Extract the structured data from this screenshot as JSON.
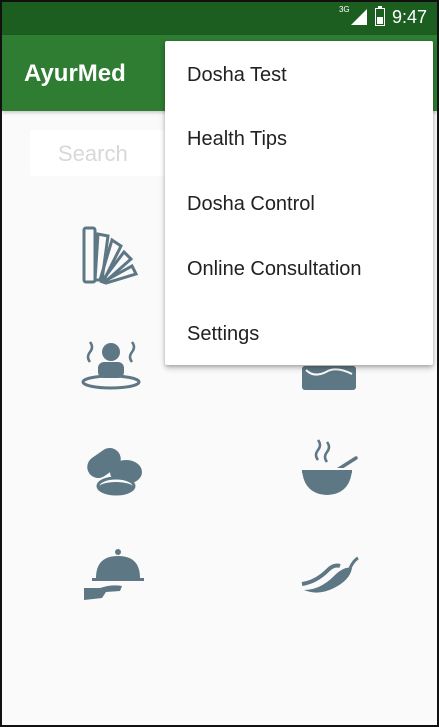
{
  "status": {
    "network": "3G",
    "time": "9:47",
    "battery_level": 0.5
  },
  "app": {
    "title": "AyurMed"
  },
  "search": {
    "placeholder": "Search"
  },
  "grid": [
    {
      "icon": "color-swatch-fan-icon"
    },
    {
      "icon": "hot-bath-person-icon"
    },
    {
      "icon": "ayurveda-treatment-icon"
    },
    {
      "icon": "pills-capsules-icon"
    },
    {
      "icon": "steaming-bowl-icon"
    },
    {
      "icon": "serving-cloche-hand-icon"
    },
    {
      "icon": "chili-pepper-icon"
    }
  ],
  "overflow_menu": {
    "items": [
      {
        "label": "Dosha Test"
      },
      {
        "label": "Health Tips"
      },
      {
        "label": "Dosha Control"
      },
      {
        "label": "Online Consultation"
      },
      {
        "label": "Settings"
      }
    ]
  },
  "colors": {
    "status_bar": "#1b5e20",
    "app_bar": "#2e7d32",
    "icon": "#5e7784"
  }
}
